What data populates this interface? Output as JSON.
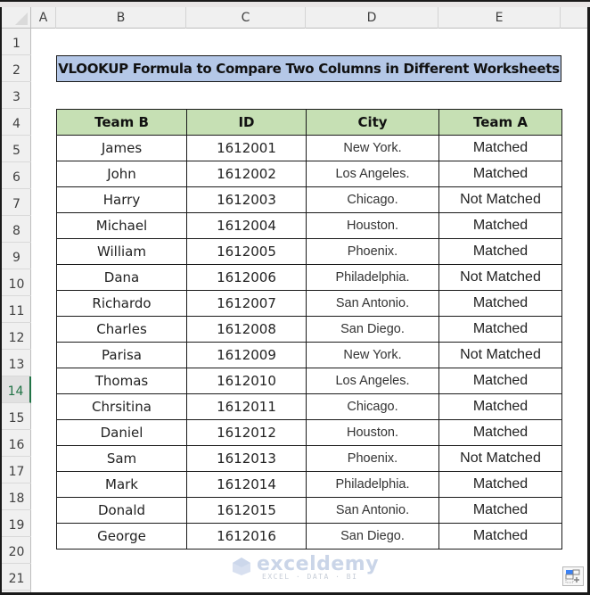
{
  "sheet": {
    "column_headers": [
      "A",
      "B",
      "C",
      "D",
      "E"
    ],
    "row_headers": [
      "1",
      "2",
      "3",
      "4",
      "5",
      "6",
      "7",
      "8",
      "9",
      "10",
      "11",
      "12",
      "13",
      "14",
      "15",
      "16",
      "17",
      "18",
      "19",
      "20",
      "21"
    ],
    "selected_row": "14",
    "selection_color": "#217346"
  },
  "title": {
    "text": "VLOOKUP Formula to Compare Two Columns in Different Worksheets",
    "fill_color": "#b4c7e7"
  },
  "table": {
    "header_fill_color": "#c6e0b4",
    "columns": [
      "Team B",
      "ID",
      "City",
      "Team A"
    ],
    "rows": [
      [
        "James",
        "1612001",
        "New York.",
        "Matched"
      ],
      [
        "John",
        "1612002",
        "Los Angeles.",
        "Matched"
      ],
      [
        "Harry",
        "1612003",
        "Chicago.",
        "Not Matched"
      ],
      [
        "Michael",
        "1612004",
        "Houston.",
        "Matched"
      ],
      [
        "William",
        "1612005",
        "Phoenix.",
        "Matched"
      ],
      [
        "Dana",
        "1612006",
        "Philadelphia.",
        "Not Matched"
      ],
      [
        "Richardo",
        "1612007",
        "San Antonio.",
        "Matched"
      ],
      [
        "Charles",
        "1612008",
        "San Diego.",
        "Matched"
      ],
      [
        "Parisa",
        "1612009",
        "New York.",
        "Not Matched"
      ],
      [
        "Thomas",
        "1612010",
        "Los Angeles.",
        "Matched"
      ],
      [
        "Chrsitina",
        "1612011",
        "Chicago.",
        "Matched"
      ],
      [
        "Daniel",
        "1612012",
        "Houston.",
        "Matched"
      ],
      [
        "Sam",
        "1612013",
        "Phoenix.",
        "Not Matched"
      ],
      [
        "Mark",
        "1612014",
        "Philadelphia.",
        "Matched"
      ],
      [
        "Donald",
        "1612015",
        "San Antonio.",
        "Matched"
      ],
      [
        "George",
        "1612016",
        "San Diego.",
        "Matched"
      ]
    ]
  },
  "watermark": {
    "brand": "exceldemy",
    "tagline": "EXCEL · DATA · BI"
  },
  "quick_analysis": {
    "icon": "quick-analysis-icon"
  }
}
